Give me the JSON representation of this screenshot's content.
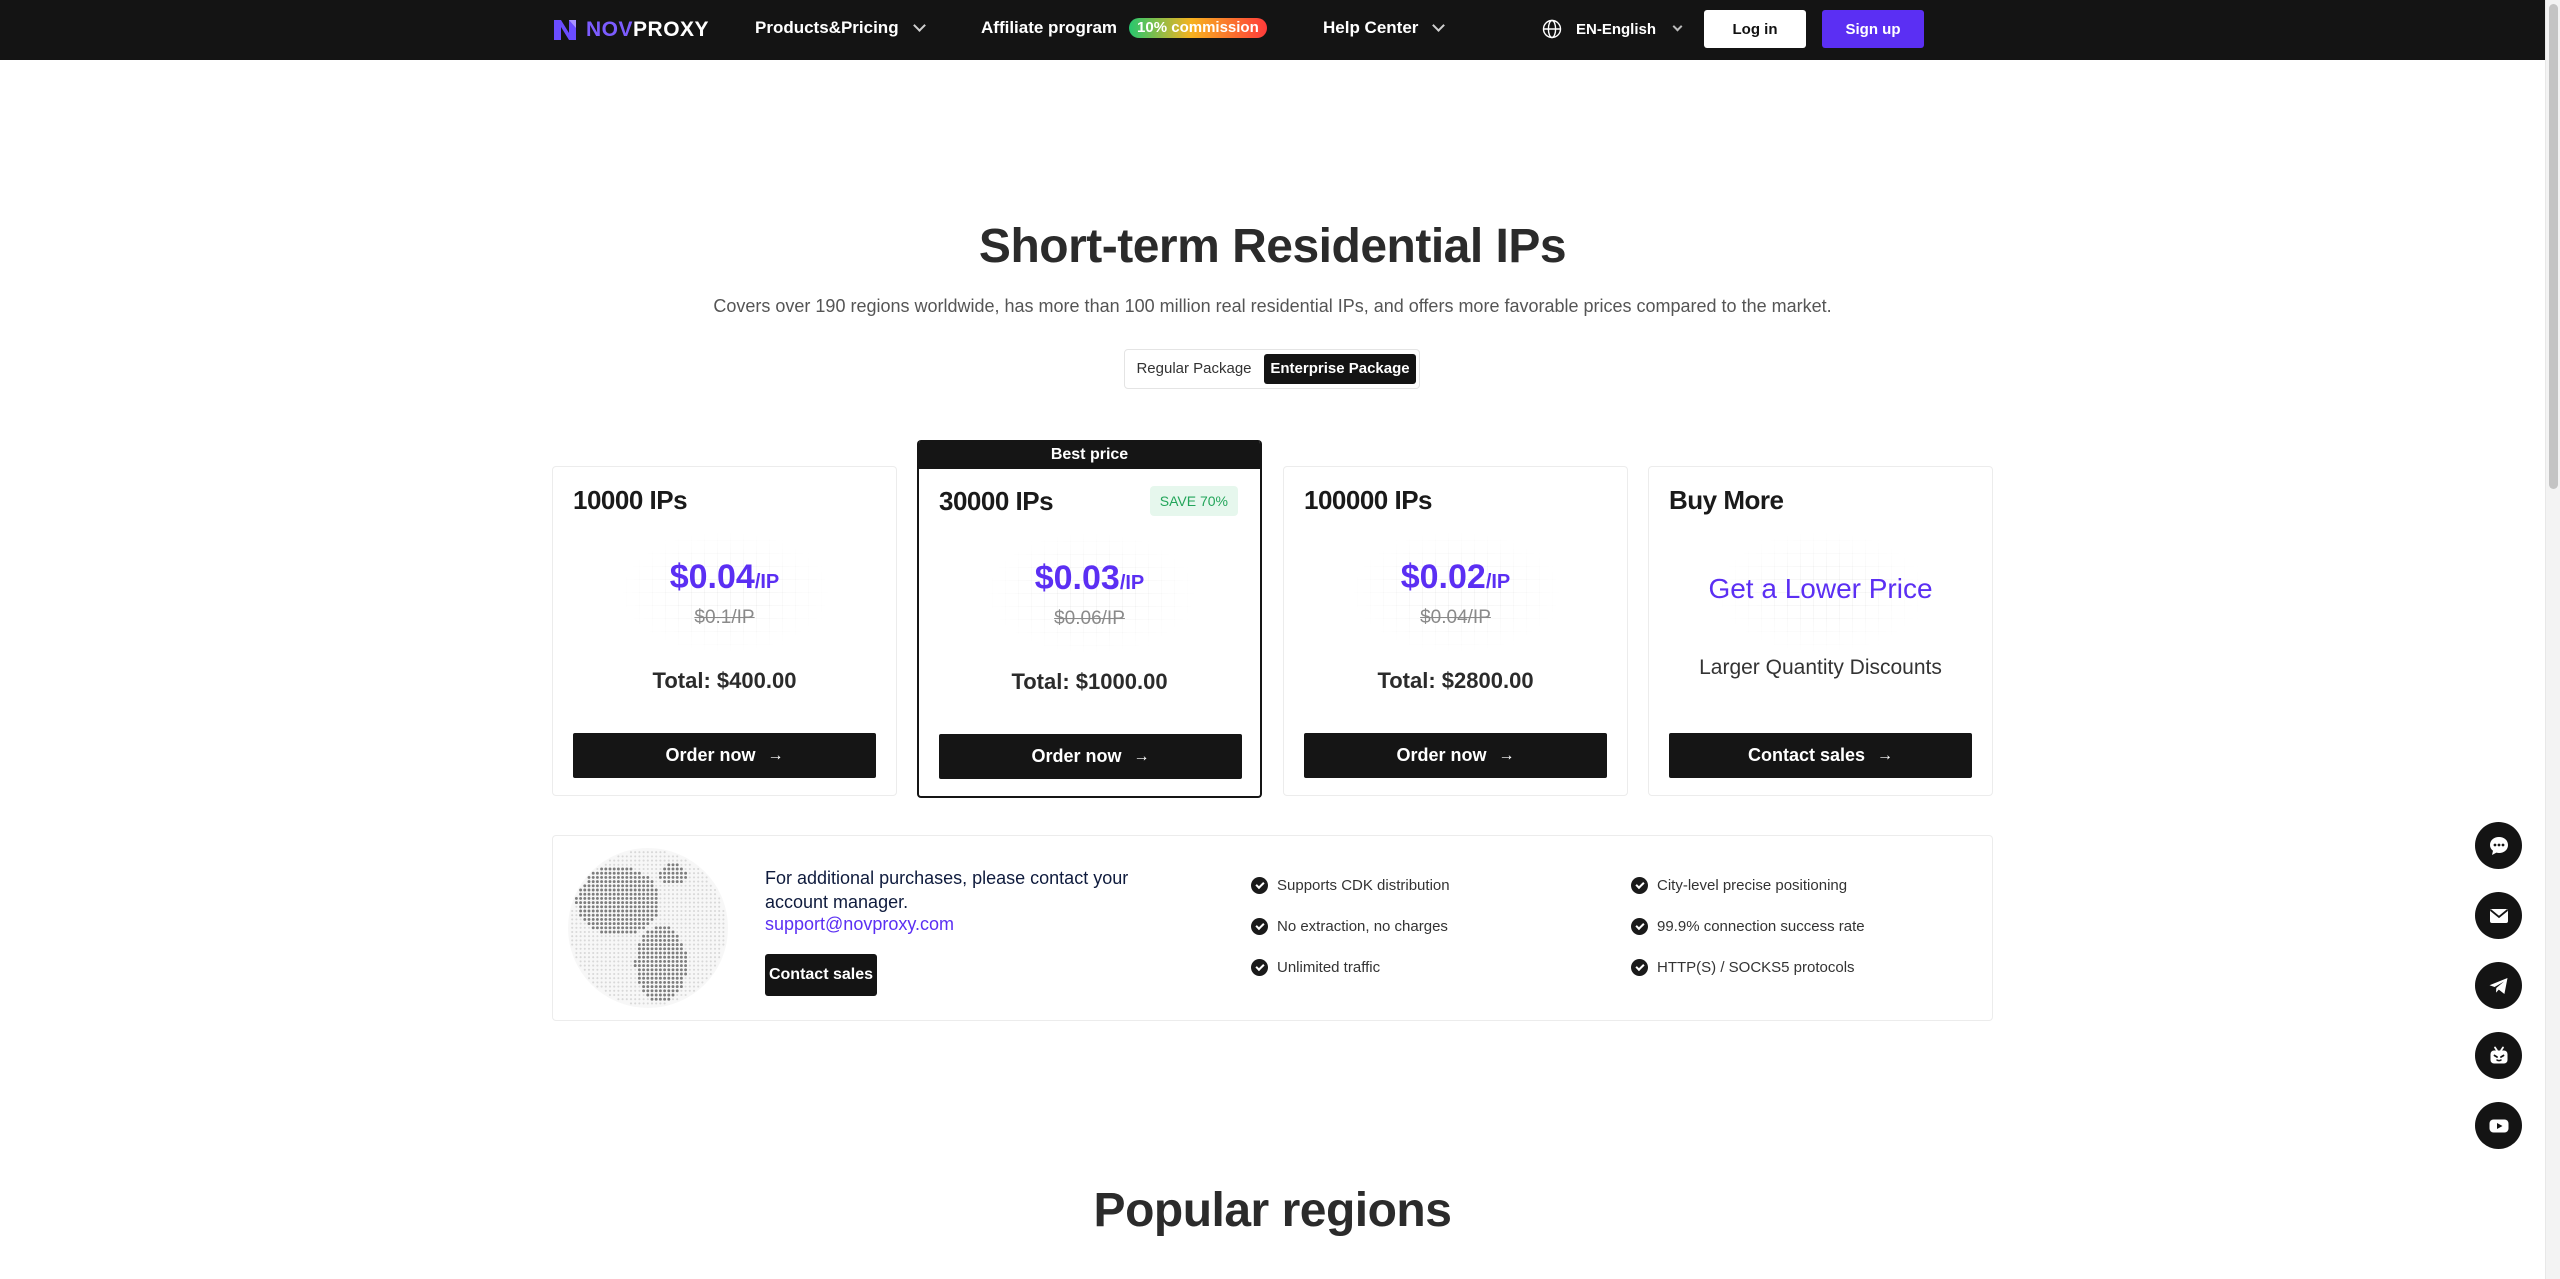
{
  "nav": {
    "logo_prefix": "NOV",
    "logo_suffix": "PROXY",
    "products": "Products&Pricing",
    "affiliate": "Affiliate program",
    "commission_badge": "10% commission",
    "help": "Help Center",
    "language": "EN-English",
    "login": "Log in",
    "signup": "Sign up"
  },
  "hero": {
    "title": "Short-term Residential IPs",
    "subtitle": "Covers over 190 regions worldwide, has more than 100 million real residential IPs, and offers more favorable prices compared to the market.",
    "tabs": [
      "Regular Package",
      "Enterprise Package"
    ],
    "active_tab": "Enterprise Package"
  },
  "cards": [
    {
      "title": "10000 IPs",
      "price": "$0.04",
      "unit": "/IP",
      "old_price": "$0.1/IP",
      "total": "Total: $400.00",
      "button": "Order now"
    },
    {
      "title": "30000 IPs",
      "tag": "Best price",
      "badge": "SAVE 70%",
      "price": "$0.03",
      "unit": "/IP",
      "old_price": "$0.06/IP",
      "total": "Total: $1000.00",
      "button": "Order now"
    },
    {
      "title": "100000 IPs",
      "price": "$0.02",
      "unit": "/IP",
      "old_price": "$0.04/IP",
      "total": "Total: $2800.00",
      "button": "Order now"
    },
    {
      "title": "Buy More",
      "headline": "Get a Lower Price",
      "subline": "Larger Quantity Discounts",
      "button": "Contact sales"
    }
  ],
  "info": {
    "text": "For additional purchases, please contact your account manager.",
    "email": "support@novproxy.com",
    "button": "Contact sales",
    "features": [
      "Supports CDK distribution",
      "City-level precise positioning",
      "No extraction, no charges",
      "99.9% connection success rate",
      "Unlimited traffic",
      "HTTP(S) / SOCKS5 protocols"
    ]
  },
  "regions": {
    "title": "Popular regions"
  },
  "floating_icons": [
    "chat-icon",
    "mail-icon",
    "telegram-icon",
    "bot-icon",
    "youtube-icon"
  ],
  "colors": {
    "accent": "#5b2ff3",
    "dark": "#141414",
    "save_green": "#23a55a"
  }
}
